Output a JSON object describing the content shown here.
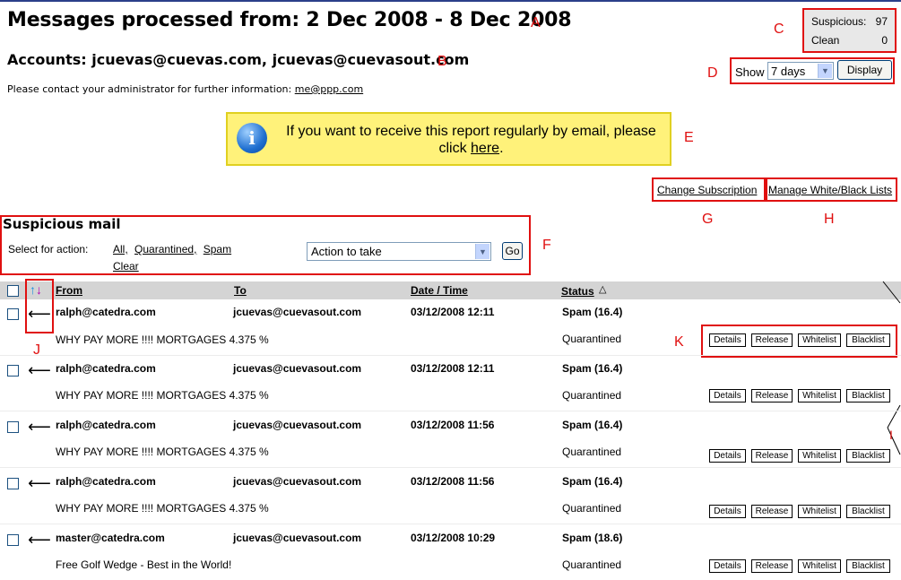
{
  "header": {
    "title": "Messages processed from: 2 Dec 2008 - 8 Dec 2008",
    "accounts": "Accounts: jcuevas@cuevas.com, jcuevas@cuevasout.com",
    "contact_text": "Please contact your administrator for further information:",
    "contact_email": "me@ppp.com"
  },
  "counts": {
    "suspicious_label": "Suspicious:",
    "suspicious_value": "97",
    "clean_label": "Clean",
    "clean_value": "0"
  },
  "show": {
    "label": "Show",
    "selected": "7 days",
    "button": "Display"
  },
  "info": {
    "text": "If you want to receive this report regularly by email, please click",
    "link": "here",
    "period": "."
  },
  "links": {
    "change_subscription": "Change Subscription",
    "manage_lists": "Manage White/Black Lists"
  },
  "suspicious": {
    "title": "Suspicious mail",
    "select_label": "Select for action:",
    "all": "All,",
    "quarantined": "Quarantined,",
    "spam": "Spam",
    "clear": "Clear",
    "action_placeholder": "Action to take",
    "go": "Go"
  },
  "table": {
    "headers": {
      "from": "From",
      "to": "To",
      "datetime": "Date / Time",
      "status": "Status"
    },
    "sort_icon": "sort-up-down-arrows",
    "rows": [
      {
        "from": "ralph@catedra.com",
        "to": "jcuevas@cuevasout.com",
        "datetime": "03/12/2008 12:11",
        "status": "Spam (16.4)",
        "subject": "WHY PAY MORE !!!! MORTGAGES 4.375 %",
        "state": "Quarantined"
      },
      {
        "from": "ralph@catedra.com",
        "to": "jcuevas@cuevasout.com",
        "datetime": "03/12/2008 12:11",
        "status": "Spam (16.4)",
        "subject": "WHY PAY MORE !!!! MORTGAGES 4.375 %",
        "state": "Quarantined"
      },
      {
        "from": "ralph@catedra.com",
        "to": "jcuevas@cuevasout.com",
        "datetime": "03/12/2008 11:56",
        "status": "Spam (16.4)",
        "subject": "WHY PAY MORE !!!! MORTGAGES 4.375 %",
        "state": "Quarantined"
      },
      {
        "from": "ralph@catedra.com",
        "to": "jcuevas@cuevasout.com",
        "datetime": "03/12/2008 11:56",
        "status": "Spam (16.4)",
        "subject": "WHY PAY MORE !!!! MORTGAGES 4.375 %",
        "state": "Quarantined"
      },
      {
        "from": "master@catedra.com",
        "to": "jcuevas@cuevasout.com",
        "datetime": "03/12/2008 10:29",
        "status": "Spam (18.6)",
        "subject": "Free Golf Wedge - Best in the World!",
        "state": "Quarantined"
      }
    ],
    "row_buttons": {
      "details": "Details",
      "release": "Release",
      "whitelist": "Whitelist",
      "blacklist": "Blacklist"
    }
  },
  "annotations": {
    "a": "A",
    "b": "B",
    "c": "C",
    "d": "D",
    "e": "E",
    "f": "F",
    "g": "G",
    "h": "H",
    "i": "I",
    "j": "J",
    "k": "K"
  },
  "colors": {
    "annotation_red": "#e01010",
    "info_yellow": "#fff27a",
    "header_gray": "#d4d4d4",
    "counts_gray": "#e8e8e8"
  }
}
